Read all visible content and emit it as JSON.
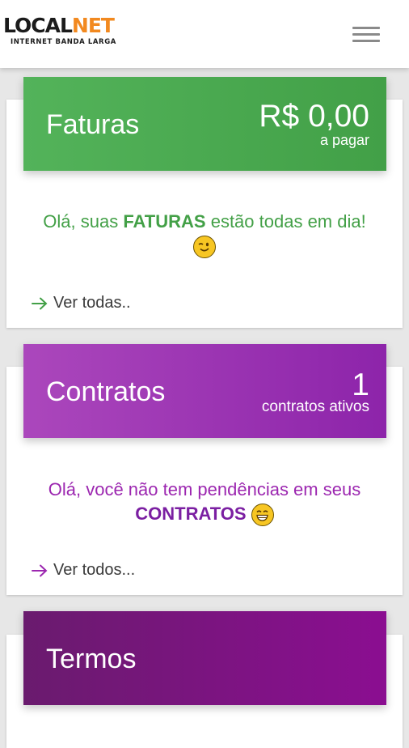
{
  "header": {
    "logo_local": "LOCAL",
    "logo_net": "NET",
    "logo_tagline": "INTERNET BANDA LARGA",
    "menu_icon": "hamburger-menu-icon"
  },
  "faturas": {
    "title": "Faturas",
    "amount": "R$ 0,00",
    "amount_label": "a pagar",
    "message_prefix": "Olá, suas ",
    "message_highlight": "FATURAS",
    "message_suffix": " estão todas em dia!",
    "emoji": "winking-face-emoji",
    "link_label": "Ver todas..",
    "accent_color": "#43a047"
  },
  "contratos": {
    "title": "Contratos",
    "count": "1",
    "count_label": "contratos ativos",
    "message_prefix": "Olá, você não tem pendências em seus",
    "message_highlight": "CONTRATOS",
    "emoji": "grinning-face-emoji",
    "link_label": "Ver todos...",
    "accent_color": "#9c27b0"
  },
  "termos": {
    "title": "Termos",
    "accent_color": "#7b1276"
  }
}
